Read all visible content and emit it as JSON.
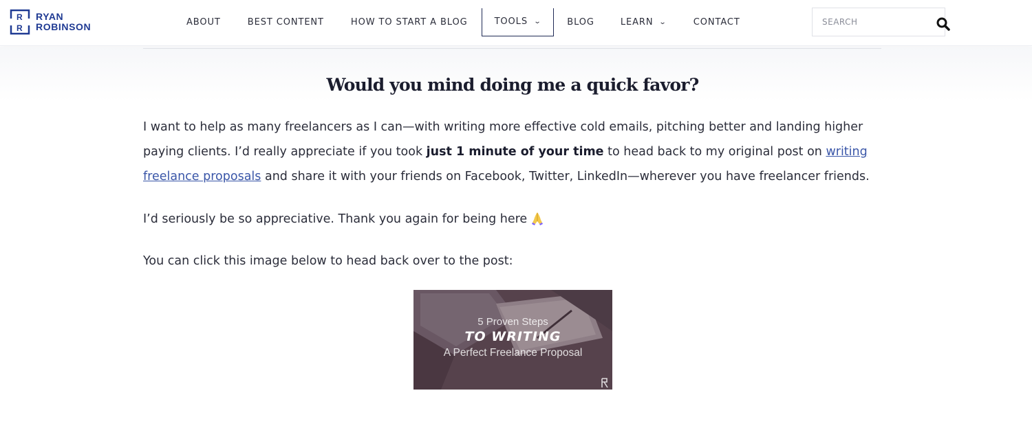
{
  "brand": {
    "name_line1": "RYAN",
    "name_line2": "ROBINSON",
    "logo_color": "#1f3a93"
  },
  "nav": {
    "items": [
      {
        "label": "ABOUT",
        "has_dropdown": false
      },
      {
        "label": "BEST CONTENT",
        "has_dropdown": false
      },
      {
        "label": "HOW TO START A BLOG",
        "has_dropdown": false
      },
      {
        "label": "TOOLS",
        "has_dropdown": true,
        "active": true
      },
      {
        "label": "BLOG",
        "has_dropdown": false
      },
      {
        "label": "LEARN",
        "has_dropdown": true
      },
      {
        "label": "CONTACT",
        "has_dropdown": false
      }
    ],
    "chevron": "⌄"
  },
  "search": {
    "placeholder": "SEARCH",
    "icon": "search-icon"
  },
  "main": {
    "heading": "Would you mind doing me a quick favor?",
    "para1": {
      "text_before_bold": "I want to help as many freelancers as I can—with writing more effective cold emails, pitching better and landing higher paying clients. I’d really appreciate if you took ",
      "bold": "just 1 minute of your time",
      "text_after_bold": " to head back to my original post on ",
      "link": "writing freelance proposals",
      "text_end": " and share it with your friends on Facebook, Twitter, LinkedIn—wherever you have freelancer friends."
    },
    "para2": "I’d seriously be so appreciative. Thank you again for being here",
    "para2_emoji": "praying-hands-emoji",
    "para3": "You can click this image below to head back over to the post:",
    "promo": {
      "line1": "5 Proven Steps",
      "line2": "TO WRITING",
      "line3": "A Perfect Freelance Proposal"
    }
  },
  "colors": {
    "text": "#2b2d3a",
    "heading": "#1b1d2e",
    "link": "#3a56a8",
    "nav_active_border": "#1f2a55"
  }
}
